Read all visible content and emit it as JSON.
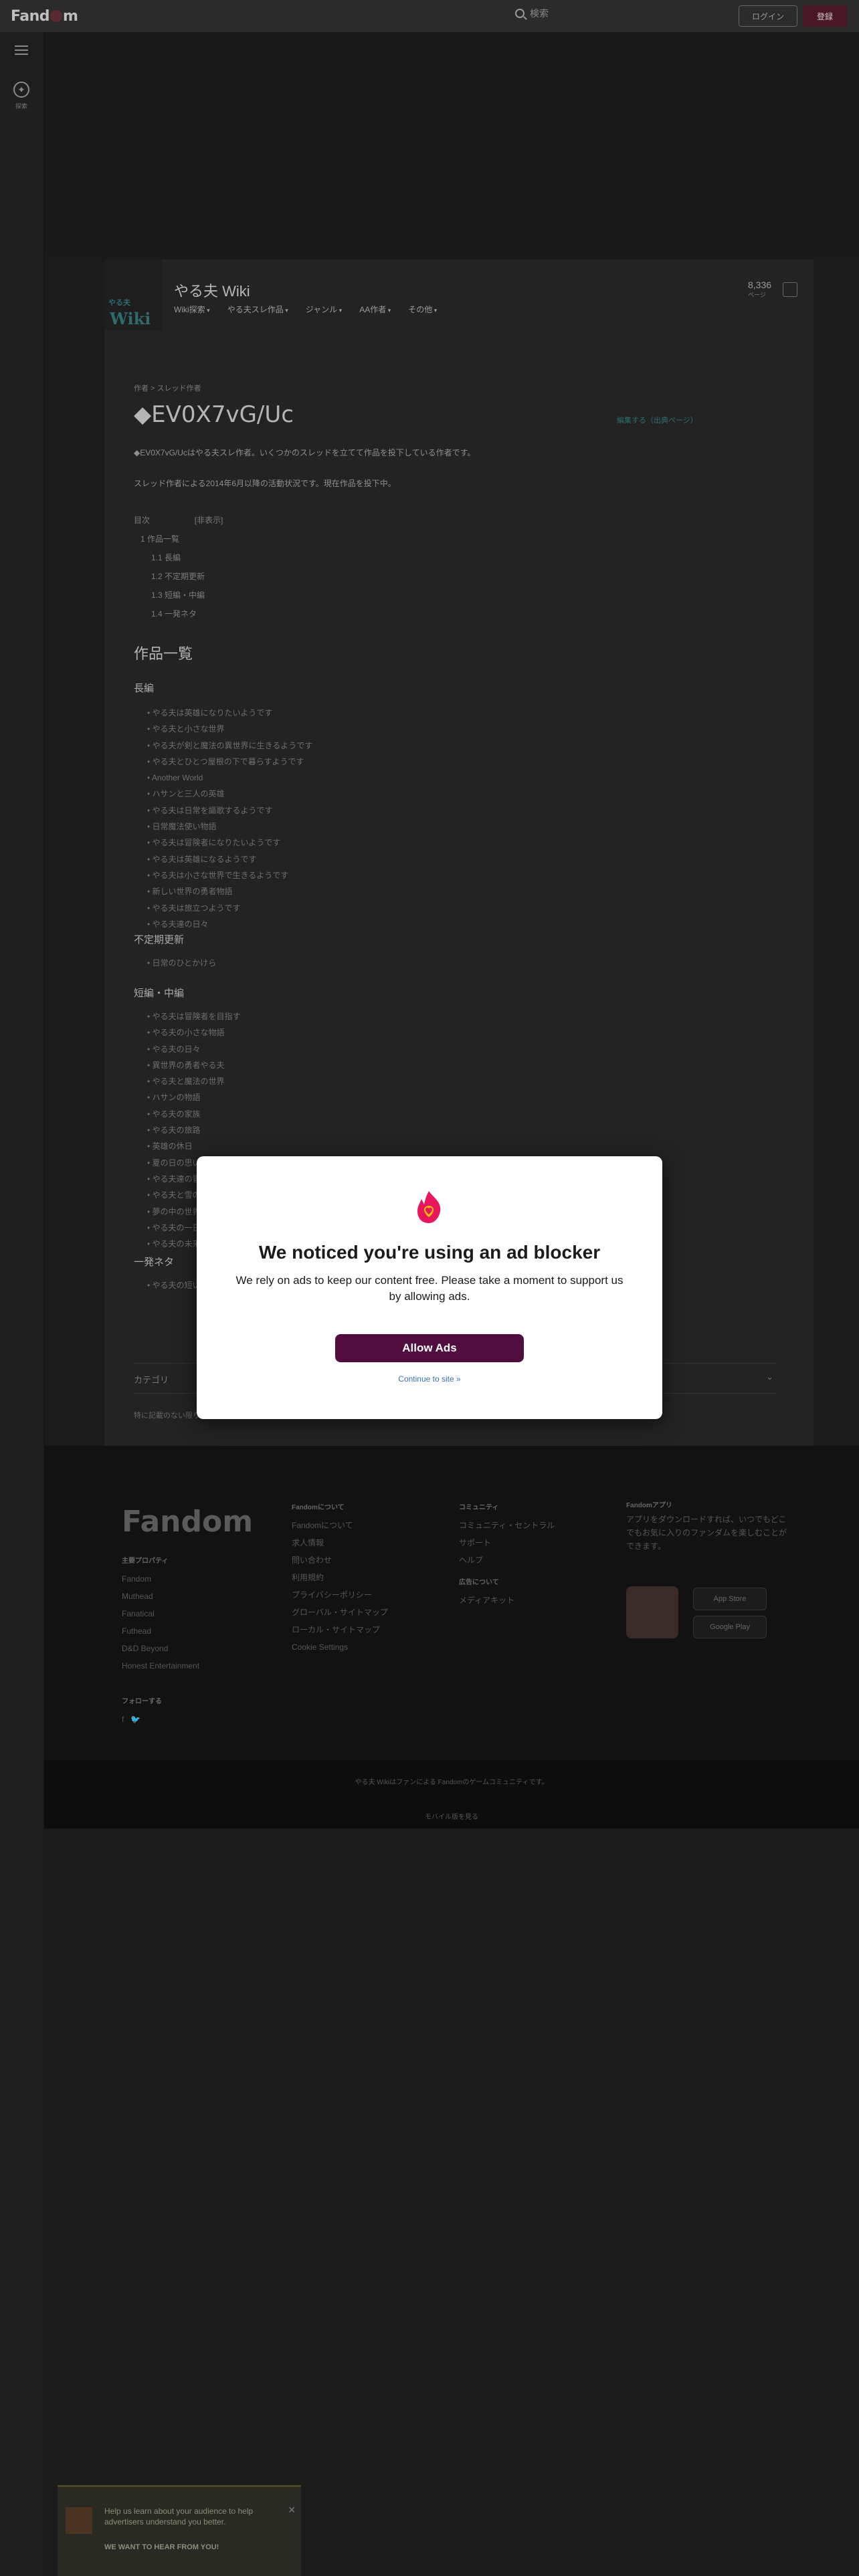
{
  "topbar": {
    "logo": "Fandom",
    "search_placeholder": "検索",
    "signin_label": "ログイン",
    "register_label": "登録"
  },
  "rail": {
    "explore_label": "探索"
  },
  "wiki": {
    "logo_small": "やる夫",
    "logo_big": "Wiki",
    "title": "やる夫 Wiki",
    "nav": [
      "Wiki探索",
      "やる夫スレ作品",
      "ジャンル",
      "AA作者",
      "その他"
    ],
    "page_count": "8,336",
    "page_count_label": "ページ"
  },
  "page": {
    "breadcrumb": "作者 > スレッド作者",
    "title": "◆EV0X7vG/Uc",
    "edit_link": "編集する（出典ページ）",
    "intro1": "◆EV0X7vG/Ucはやる夫スレ作者。いくつかのスレッドを立てて作品を投下している作者です。",
    "intro2": "スレッド作者による2014年6月以降の活動状況です。現在作品を投下中。",
    "toc_header": "目次",
    "toc_hide": "[非表示]",
    "toc": [
      "1 作品一覧",
      "1.1 長編",
      "1.2 不定期更新",
      "1.3 短編・中編",
      "1.4 一発ネタ"
    ]
  },
  "sections": {
    "works": "作品一覧",
    "long": "長編",
    "irregular": "不定期更新",
    "short": "短編・中編",
    "oneshot": "一発ネタ"
  },
  "lists": {
    "long": [
      "やる夫は英雄になりたいようです",
      "やる夫と小さな世界",
      "やる夫が剣と魔法の異世界に生きるようです",
      "やる夫とひとつ屋根の下で暮らすようです",
      "Another World",
      "ハサンと三人の英雄",
      "やる夫は日常を謳歌するようです",
      "日常魔法使い物語",
      "やる夫は冒険者になりたいようです",
      "やる夫は英雄になるようです",
      "やる夫は小さな世界で生きるようです",
      "新しい世界の勇者物語",
      "やる夫は旅立つようです",
      "やる夫達の日々"
    ],
    "irregular": [
      "日常のひとかけら"
    ],
    "short": [
      "やる夫は冒険者を目指す",
      "やる夫の小さな物語",
      "やる夫の日々",
      "異世界の勇者やる夫",
      "やる夫と魔法の世界",
      "ハサンの物語",
      "やる夫の家族",
      "やる夫の旅路",
      "英雄の休日",
      "夏の日の思い出",
      "やる夫達の冒険",
      "やる夫と雪の日",
      "夢の中の世界",
      "やる夫の一日",
      "やる夫の未来"
    ],
    "oneshot": [
      "やる夫の短い話"
    ]
  },
  "category_label": "カテゴリ",
  "footer_note": "特に記載のない限り、コミュニティのコンテンツはCC BY-SAライセンスの下で利用可能です。",
  "footer": {
    "logo": "Fandom",
    "col1_head": "主要プロパティ",
    "col1": [
      "Fandom",
      "Muthead",
      "Fanatical",
      "Futhead",
      "D&D Beyond",
      "Honest Entertainment"
    ],
    "col2_head": "Fandomについて",
    "col2": [
      "Fandomについて",
      "求人情報",
      "問い合わせ",
      "利用規約",
      "プライバシーポリシー",
      "グローバル・サイトマップ",
      "ローカル・サイトマップ",
      "Cookie Settings"
    ],
    "col3_head": "コミュニティ",
    "col3": [
      "コミュニティ・セントラル",
      "サポート",
      "ヘルプ"
    ],
    "col3b_head": "広告について",
    "col3b": [
      "メディアキット"
    ],
    "col4_head": "Fandomアプリ",
    "col4_text": "アプリをダウンロードすれば、いつでもどこでもお気に入りのファンダムを楽しむことができます。",
    "follow_head": "フォローする",
    "app_store": "App Store",
    "google_play": "Google Play",
    "bottom1": "やる夫 Wikiはファンによる Fandomのゲームコミュニティです。",
    "bottom2": "モバイル版を見る"
  },
  "feedback": {
    "text": "Help us learn about your audience to help advertisers understand you better.",
    "cta": "WE WANT TO HEAR FROM YOU!"
  },
  "modal": {
    "title": "We noticed you're using an ad blocker",
    "message": "We rely on ads to keep our content free. Please take a moment to support us by allowing ads.",
    "allow_label": "Allow Ads",
    "continue_label": "Continue to site »",
    "accent_color": "#520d3f"
  }
}
